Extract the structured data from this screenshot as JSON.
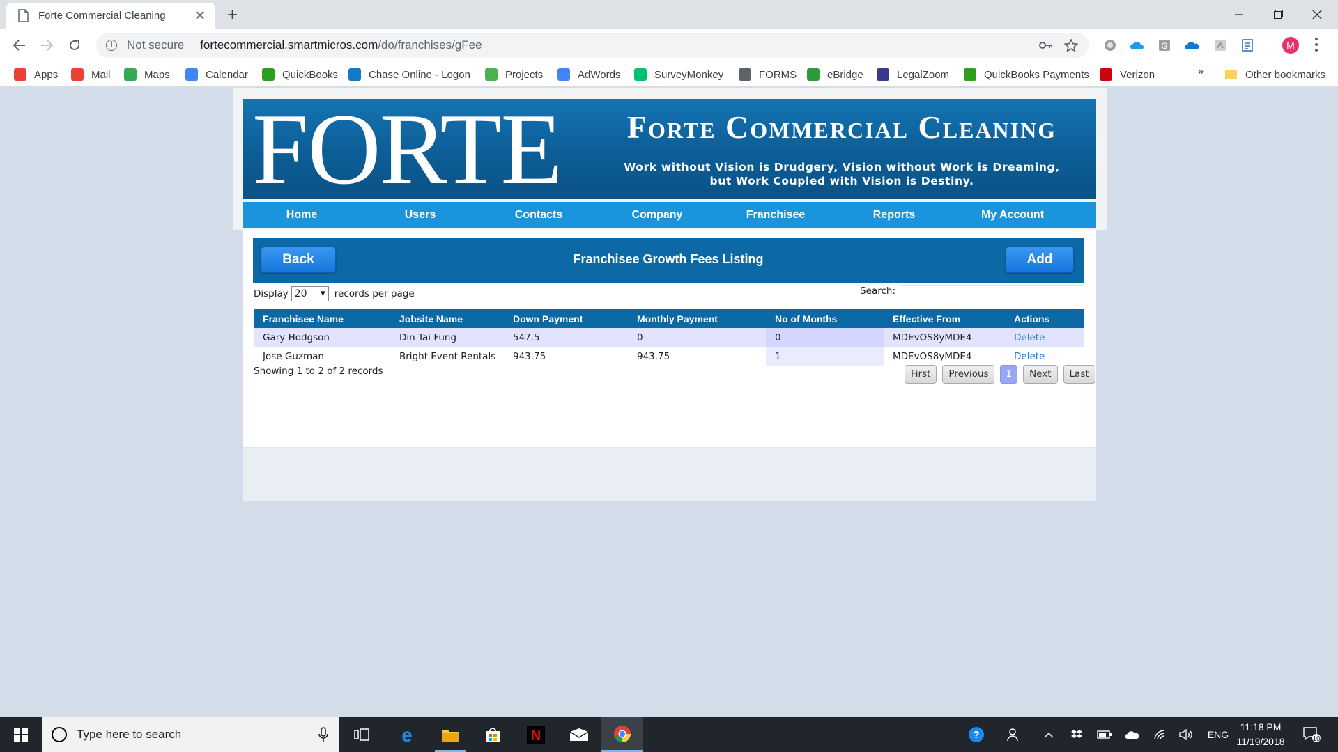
{
  "browser": {
    "tab_title": "Forte Commercial Cleaning",
    "new_tab": "+",
    "security": "Not secure",
    "url_host": "fortecommercial.smartmicros.com",
    "url_path": "/do/franchises/gFee",
    "profile_initial": "M"
  },
  "bookmarks": [
    {
      "label": "Apps",
      "icon": "apps-grid-icon",
      "color": "#ea4335"
    },
    {
      "label": "Mail",
      "icon": "gmail-icon",
      "color": "#ea4335"
    },
    {
      "label": "Maps",
      "icon": "maps-icon",
      "color": "#34a853"
    },
    {
      "label": "Calendar",
      "icon": "calendar-icon",
      "color": "#4285f4"
    },
    {
      "label": "QuickBooks",
      "icon": "quickbooks-icon",
      "color": "#2ca01c"
    },
    {
      "label": "Chase Online - Logon",
      "icon": "chase-icon",
      "color": "#117aca"
    },
    {
      "label": "Projects",
      "icon": "projects-icon",
      "color": "#4caf50"
    },
    {
      "label": "AdWords",
      "icon": "google-icon",
      "color": "#4285f4"
    },
    {
      "label": "SurveyMonkey",
      "icon": "surveymonkey-icon",
      "color": "#00bf6f"
    },
    {
      "label": "FORMS",
      "icon": "document-icon",
      "color": "#5f6368"
    },
    {
      "label": "eBridge",
      "icon": "ebridge-icon",
      "color": "#2e9b3a"
    },
    {
      "label": "LegalZoom",
      "icon": "legalzoom-icon",
      "color": "#3a3a8c"
    },
    {
      "label": "QuickBooks Payments",
      "icon": "quickbooks-icon",
      "color": "#2ca01c"
    },
    {
      "label": "Verizon",
      "icon": "verizon-icon",
      "color": "#cd040b"
    }
  ],
  "bookmarks_more": "»",
  "bookmarks_other": "Other bookmarks",
  "site": {
    "logo": "FORTE",
    "brand": "Forte Commercial Cleaning",
    "motto_line1": "Work without Vision is Drudgery, Vision without Work is Dreaming,",
    "motto_line2": "but Work Coupled with Vision is Destiny.",
    "nav": [
      "Home",
      "Users",
      "Contacts",
      "Company",
      "Franchisee",
      "Reports",
      "My Account"
    ]
  },
  "panel": {
    "back_label": "Back",
    "title": "Franchisee Growth Fees Listing",
    "add_label": "Add"
  },
  "listing": {
    "display_label": "Display",
    "per_page": "20",
    "per_page_suffix": "records per page",
    "search_label": "Search:",
    "search_value": "",
    "columns": [
      "Franchisee Name",
      "Jobsite Name",
      "Down Payment",
      "Monthly Payment",
      "No of Months",
      "Effective From",
      "Actions"
    ],
    "rows": [
      {
        "franchisee": "Gary Hodgson",
        "jobsite": "Din Tai Fung",
        "down": "547.5",
        "monthly": "0",
        "months": "0",
        "effective": "MDEvOS8yMDE4",
        "action": "Delete"
      },
      {
        "franchisee": "Jose Guzman",
        "jobsite": "Bright Event Rentals",
        "down": "943.75",
        "monthly": "943.75",
        "months": "1",
        "effective": "MDEvOS8yMDE4",
        "action": "Delete"
      }
    ],
    "info": "Showing 1 to 2 of 2 records",
    "pager": {
      "first": "First",
      "previous": "Previous",
      "current": "1",
      "next": "Next",
      "last": "Last"
    }
  },
  "taskbar": {
    "search_placeholder": "Type here to search",
    "lang": "ENG",
    "time": "11:18 PM",
    "date": "11/19/2018",
    "notifications": "10"
  }
}
